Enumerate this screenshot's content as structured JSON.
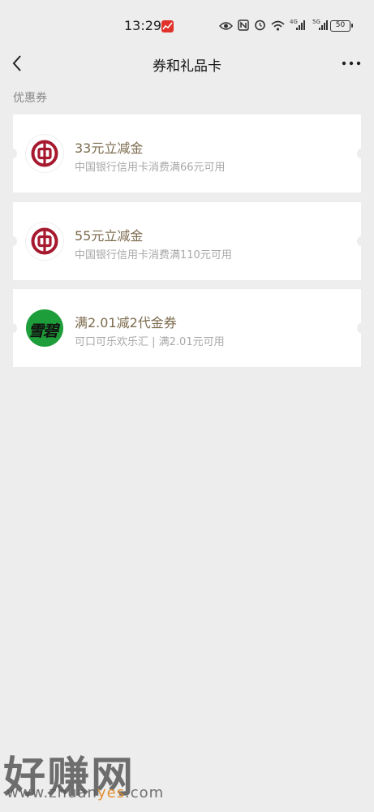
{
  "status_bar": {
    "time": "13:29",
    "battery": "50",
    "icons": [
      "eye-icon",
      "nfc-icon",
      "alarm-icon",
      "wifi-icon",
      "signal-4g-icon",
      "signal-5g-icon",
      "battery-icon"
    ]
  },
  "nav": {
    "title": "券和礼品卡"
  },
  "section_label": "优惠券",
  "coupons": [
    {
      "title": "33元立减金",
      "desc": "中国银行信用卡消费满66元可用",
      "logo": "bank-of-china-logo"
    },
    {
      "title": "55元立减金",
      "desc": "中国银行信用卡消费满110元可用",
      "logo": "bank-of-china-logo"
    },
    {
      "title": "满2.01减2代金券",
      "desc": "可口可乐欢乐汇 | 满2.01元可用",
      "logo": "sprite-logo",
      "logo_text": "雪碧"
    }
  ],
  "watermark": {
    "text": "好赚网",
    "url_prefix": "www.zhuan",
    "url_highlight": "yes",
    "url_suffix": ".com"
  },
  "colors": {
    "background": "#ededed",
    "coupon_title": "#7c6b4e",
    "boc_red": "#a6192e",
    "sprite_green": "#1e9e3a"
  }
}
